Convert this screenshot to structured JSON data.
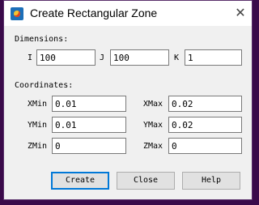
{
  "window": {
    "title": "Create Rectangular Zone",
    "close_glyph": "✕"
  },
  "dimensions": {
    "section_label": "Dimensions:",
    "i_label": "I",
    "i_value": "100",
    "j_label": "J",
    "j_value": "100",
    "k_label": "K",
    "k_value": "1"
  },
  "coordinates": {
    "section_label": "Coordinates:",
    "xmin_label": "XMin",
    "xmin_value": "0.01",
    "xmax_label": "XMax",
    "xmax_value": "0.02",
    "ymin_label": "YMin",
    "ymin_value": "0.01",
    "ymax_label": "YMax",
    "ymax_value": "0.02",
    "zmin_label": "ZMin",
    "zmin_value": "0",
    "zmax_label": "ZMax",
    "zmax_value": "0"
  },
  "buttons": {
    "create": "Create",
    "close": "Close",
    "help": "Help"
  }
}
